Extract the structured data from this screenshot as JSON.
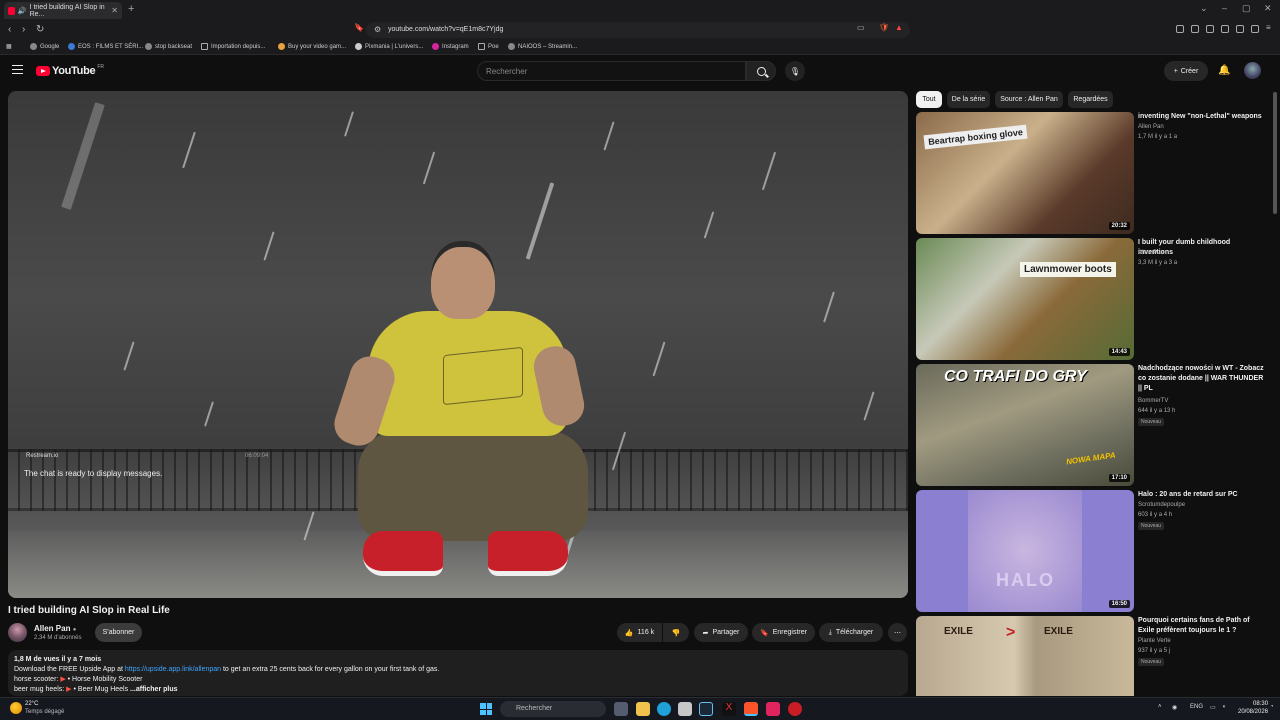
{
  "browser": {
    "tab_title": "I tried building AI Slop in Re...",
    "url": "youtube.com/watch?v=qE1m8c7Yjdg",
    "bookmarks": [
      "Google",
      "EOS : FILMS ET SÉRI...",
      "stop backseat",
      "Importation depuis...",
      "Buy your video gam...",
      "Pixmania | L'univers...",
      "Instagram",
      "Poe",
      "NAIOOS – Streamin..."
    ]
  },
  "masthead": {
    "logo_text": "YouTube",
    "country": "FR",
    "search_placeholder": "Rechercher",
    "create_label": "Créer"
  },
  "player": {
    "overlay_source": "Restream.io",
    "overlay_time": "06:09:04",
    "overlay_chat": "The chat is ready to display messages."
  },
  "video": {
    "title": "I tried building AI Slop in Real Life",
    "channel": "Allen Pan",
    "subscribers": "2,34 M d'abonnés",
    "subscribe_label": "S'abonner",
    "likes": "116 k",
    "share_label": "Partager",
    "save_label": "Enregistrer",
    "download_label": "Télécharger",
    "description": {
      "meta": "1,8 M de vues  il y a 7 mois",
      "line1_pre": "Download the FREE Upside App at ",
      "line1_link": "https://upside.app.link/allenpan",
      "line1_post": " to get an extra 25 cents back for every gallon on your first tank of gas.",
      "line2_label": "horse scooter:",
      "line2_link": "• Horse Mobility Scooter",
      "line3_label": "beer mug heels:",
      "line3_link": "• Beer Mug Heels",
      "more": "...afficher plus"
    }
  },
  "filters": [
    "Tout",
    "De la série",
    "Source : Allen Pan",
    "Regardées"
  ],
  "recommendations": [
    {
      "title": "inventing New \"non-Lethal\" weapons",
      "channel": "Allen Pan",
      "views": "1,7 M",
      "age": "il y a 1 a",
      "duration": "20:32",
      "thumb_text": "Beartrap boxing glove",
      "badge": ""
    },
    {
      "title": "I built your dumb childhood inventions",
      "channel": "Allen Pan",
      "views": "3,3 M",
      "age": "il y a 3 a",
      "duration": "14:43",
      "thumb_text": "Lawnmower boots",
      "badge": ""
    },
    {
      "title": "Nadchodzące nowości w WT - Zobacz co zostanie dodane || WAR THUNDER || PL",
      "channel": "BommerTV",
      "views": "644",
      "age": "il y a 13 h",
      "duration": "17:10",
      "thumb_text": "CO TRAFI DO GRY",
      "thumb_text2": "NOWA MAPA",
      "badge": "Nouveau"
    },
    {
      "title": "Halo : 20 ans de retard sur PC",
      "channel": "Scrotumdepoulpe",
      "views": "603",
      "age": "il y a 4 h",
      "duration": "16:50",
      "thumb_text": "HALO",
      "badge": "Nouveau"
    },
    {
      "title": "Pourquoi certains fans de Path of Exile préfèrent toujours le 1 ?",
      "channel": "Plante Verte",
      "views": "937",
      "age": "il y a 5 j",
      "duration": "",
      "thumb_text": "EXILE",
      "badge": "Nouveau"
    }
  ],
  "taskbar": {
    "temp": "22°C",
    "weather": "Temps dégagé",
    "search": "Rechercher",
    "lang": "ENG",
    "time": "08:30",
    "date": "20/08/2026"
  }
}
